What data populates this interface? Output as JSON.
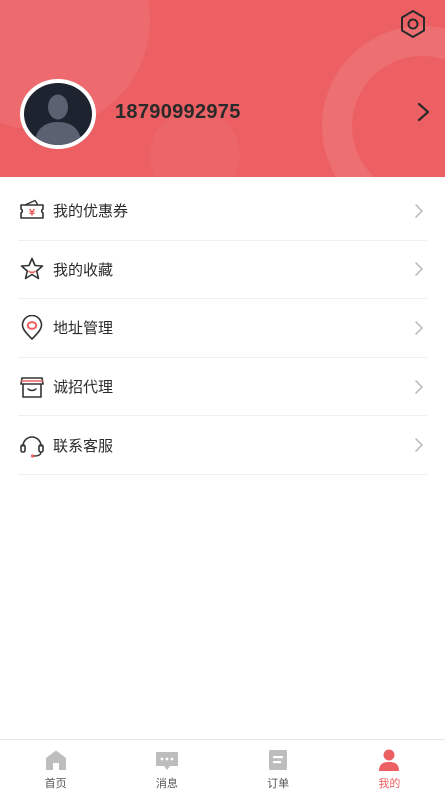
{
  "profile": {
    "phone": "18790992975"
  },
  "menu": {
    "items": [
      {
        "label": "我的优惠券",
        "icon": "coupon-icon"
      },
      {
        "label": "我的收藏",
        "icon": "star-icon"
      },
      {
        "label": "地址管理",
        "icon": "location-icon"
      },
      {
        "label": "诚招代理",
        "icon": "store-icon"
      },
      {
        "label": "联系客服",
        "icon": "headset-icon"
      }
    ]
  },
  "tabbar": {
    "items": [
      {
        "label": "首页",
        "icon": "home-icon"
      },
      {
        "label": "消息",
        "icon": "message-icon"
      },
      {
        "label": "订单",
        "icon": "order-icon"
      },
      {
        "label": "我的",
        "icon": "user-icon",
        "active": true
      }
    ]
  },
  "colors": {
    "brand": "#ec5f63",
    "inactive_icon": "#bdbdbd"
  }
}
